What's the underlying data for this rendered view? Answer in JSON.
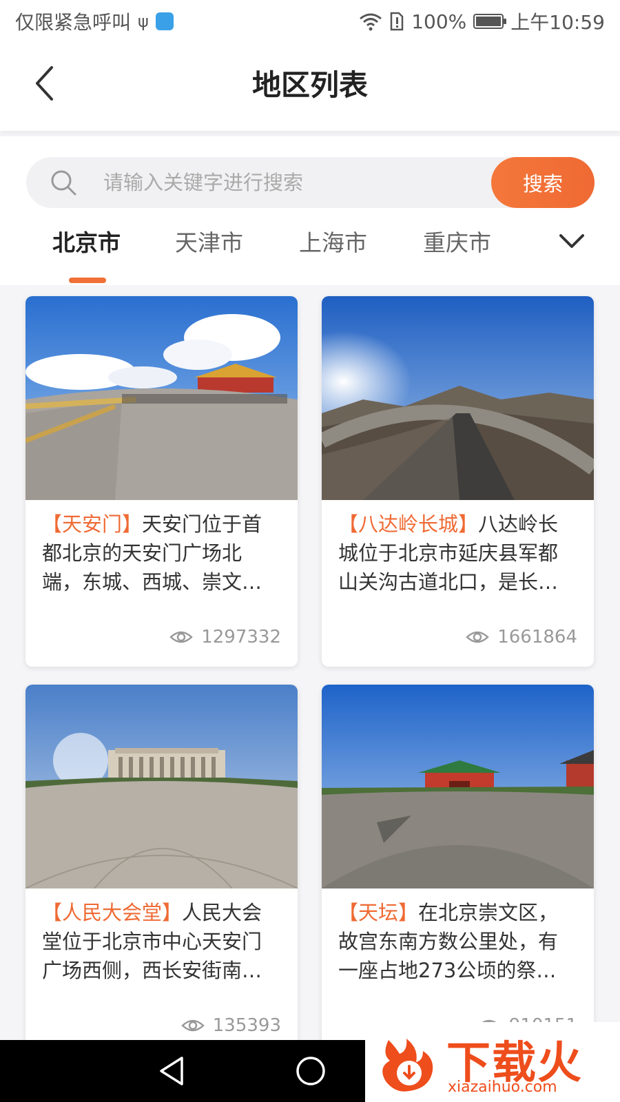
{
  "status_bar": {
    "carrier": "仅限紧急呼叫",
    "battery": "100%",
    "time": "上午10:59"
  },
  "header": {
    "title": "地区列表",
    "back_icon": "chevron-left-icon"
  },
  "search": {
    "placeholder": "请输入关键字进行搜索",
    "button_label": "搜索"
  },
  "tabs": [
    {
      "label": "北京市",
      "active": true
    },
    {
      "label": "天津市",
      "active": false
    },
    {
      "label": "上海市",
      "active": false
    },
    {
      "label": "重庆市",
      "active": false
    }
  ],
  "accent_color": "#EF6A34",
  "cards": [
    {
      "tag": "【天安门】",
      "text": "天安门位于首都北京的天安门广场北端，东城、西城、崇文…",
      "views": "1297332"
    },
    {
      "tag": "【八达岭长城】",
      "text": "八达岭长城位于北京市延庆县军都山关沟古道北口，是长…",
      "views": "1661864"
    },
    {
      "tag": "【人民大会堂】",
      "text": "人民大会堂位于北京市中心天安门广场西侧，西长安街南…",
      "views": "135393"
    },
    {
      "tag": "【天坛】",
      "text": "在北京崇文区，故宫东南方数公里处，有一座占地273公顷的祭…",
      "views": "910151"
    }
  ],
  "watermark": {
    "title": "下载火",
    "subtitle": "xiazaihuo.com"
  }
}
